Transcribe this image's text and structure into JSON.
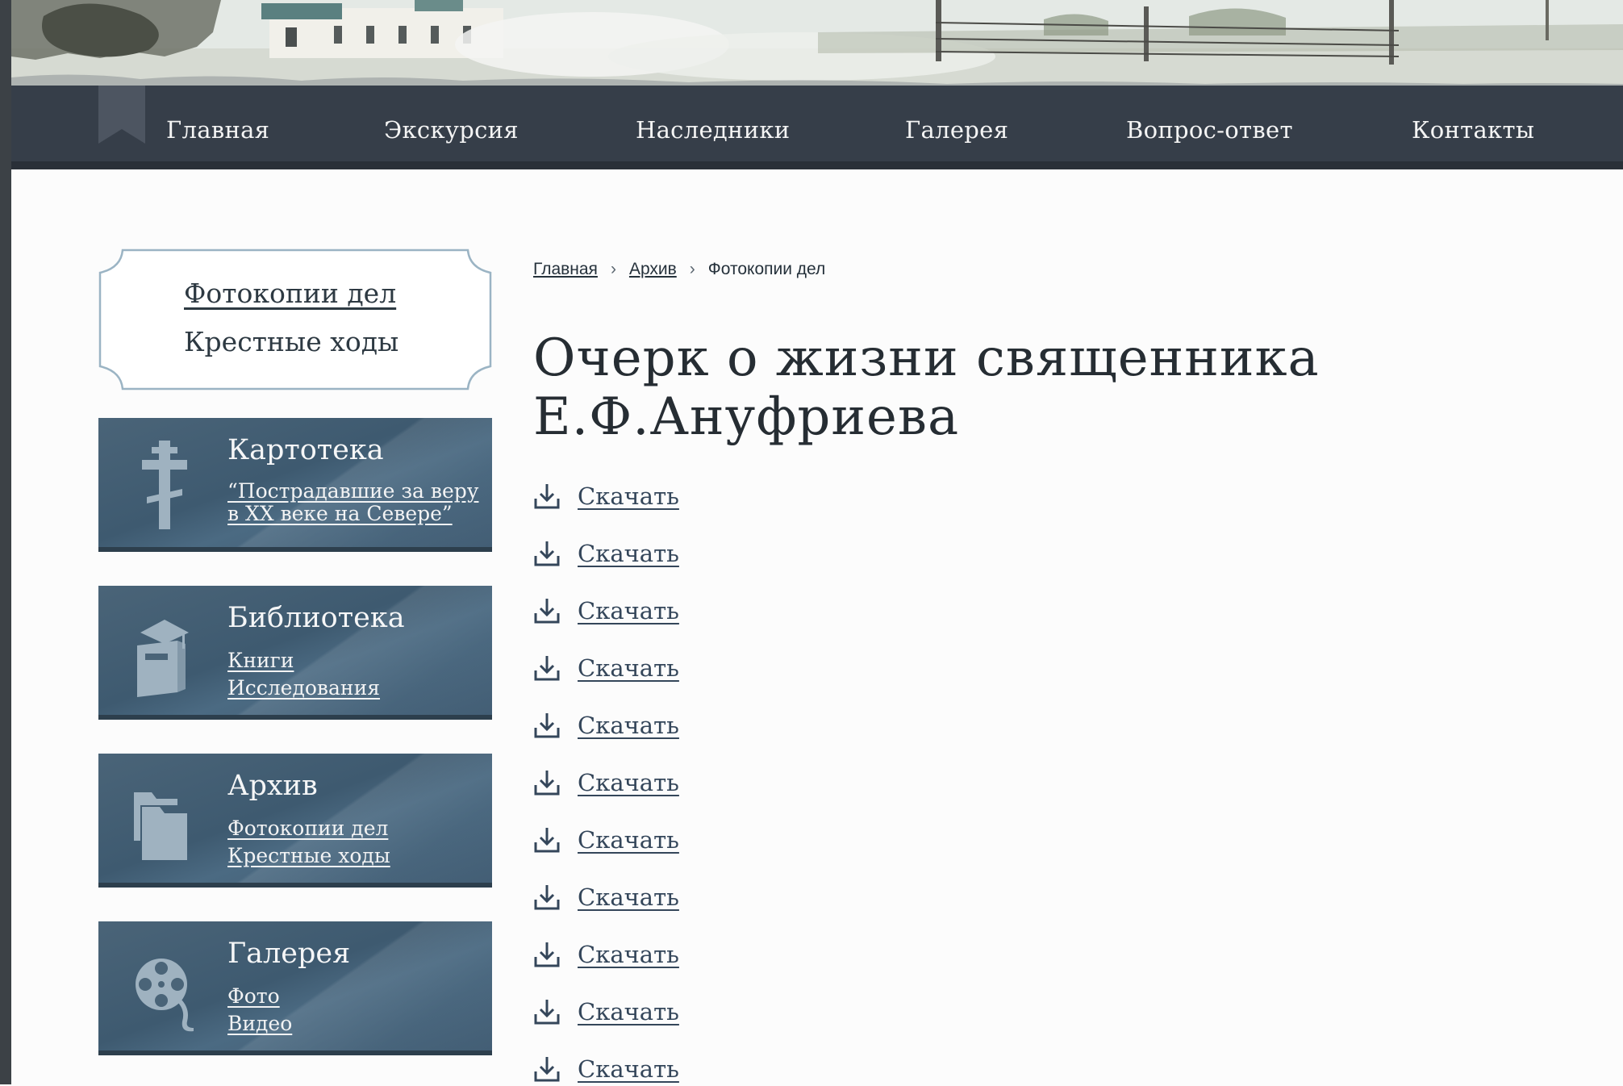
{
  "nav": {
    "items": [
      "Главная",
      "Экскурсия",
      "Наследники",
      "Галерея",
      "Вопрос-ответ",
      "Контакты"
    ]
  },
  "sidebar": {
    "subnav": [
      {
        "label": "Фотокопии дел",
        "active": true
      },
      {
        "label": "Крестные ходы",
        "active": false
      }
    ],
    "cards": [
      {
        "title": "Картотека",
        "icon": "orthodox-cross-icon",
        "links": [
          "“Пострадавшие за веру",
          "в XX веке на Севере”"
        ]
      },
      {
        "title": "Библиотека",
        "icon": "book-graduation-icon",
        "links": [
          "Книги",
          "Исследования"
        ]
      },
      {
        "title": "Архив",
        "icon": "folders-icon",
        "links": [
          "Фотокопии дел",
          "Крестные ходы"
        ]
      },
      {
        "title": "Галерея",
        "icon": "film-reel-icon",
        "links": [
          "Фото",
          "Видео"
        ]
      }
    ]
  },
  "breadcrumb": {
    "items": [
      "Главная",
      "Архив"
    ],
    "current": "Фотокопии дел",
    "separator": "›"
  },
  "main": {
    "title": "Очерк о жизни священника Е.Ф.Ануфриева",
    "downloads": [
      "Скачать",
      "Скачать",
      "Скачать",
      "Скачать",
      "Скачать",
      "Скачать",
      "Скачать",
      "Скачать",
      "Скачать",
      "Скачать",
      "Скачать"
    ],
    "download_icon": "download-icon"
  },
  "colors": {
    "nav_bg": "#363e49",
    "card_bg": "#3e5a70",
    "link": "#34465a",
    "text": "#262d33"
  }
}
